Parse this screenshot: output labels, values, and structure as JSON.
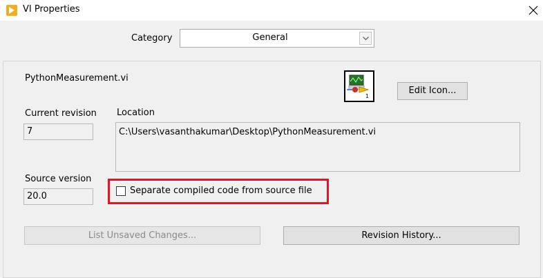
{
  "window": {
    "title": "VI Properties",
    "app_icon": "labview-play-icon",
    "close_icon": "close-icon"
  },
  "category": {
    "label": "Category",
    "selected": "General"
  },
  "vi": {
    "name": "PythonMeasurement.vi",
    "edit_icon_label": "Edit Icon..."
  },
  "current_revision": {
    "label": "Current revision",
    "value": "7"
  },
  "location": {
    "label": "Location",
    "value": "C:\\Users\\vasanthakumar\\Desktop\\PythonMeasurement.vi"
  },
  "source_version": {
    "label": "Source version",
    "value": "20.0"
  },
  "separate_compiled": {
    "label": "Separate compiled code from source file",
    "checked": false
  },
  "buttons": {
    "list_unsaved": "List Unsaved Changes...",
    "revision_history": "Revision History..."
  },
  "colors": {
    "highlight": "#e81123",
    "dialog_bg": "#f0f0f0",
    "app_icon": "#f0ad1c"
  }
}
